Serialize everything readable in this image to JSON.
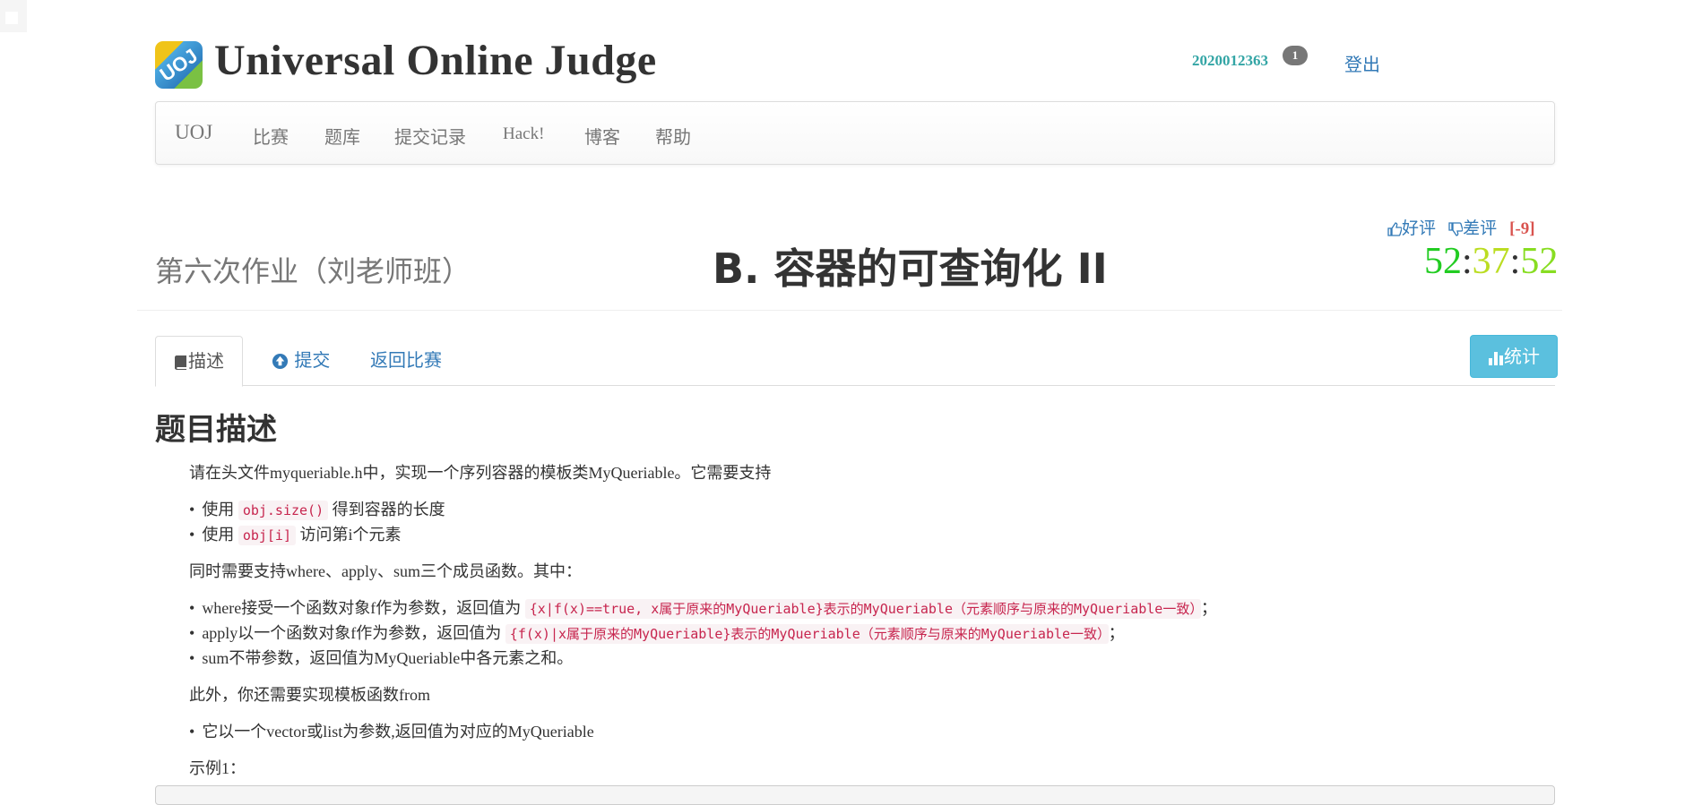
{
  "site": {
    "title": "Universal Online Judge",
    "logo_text": "UOJ"
  },
  "user": {
    "name": "2020012363",
    "badge": "1",
    "logout": "登出"
  },
  "navbar": {
    "brand": "UOJ",
    "items": [
      "比赛",
      "题库",
      "提交记录",
      "Hack!",
      "博客",
      "帮助"
    ]
  },
  "contest": {
    "name": "第六次作业（刘老师班）"
  },
  "problem": {
    "title": "B. 容器的可查询化 II"
  },
  "rating": {
    "like": "好评",
    "dislike": "差评",
    "score": "[-9]"
  },
  "timer": {
    "hours": "52",
    "minutes": "37",
    "seconds": "52",
    "colors": {
      "hours": "#22cc22",
      "minutes": "#bbdd22",
      "seconds": "#88dd22"
    }
  },
  "tabs": {
    "desc": "描述",
    "submit": "提交",
    "back": "返回比赛"
  },
  "stats_button": "统计",
  "content": {
    "heading": "题目描述",
    "intro": "请在头文件myqueriable.h中，实现一个序列容器的模板类MyQueriable。它需要支持",
    "list1": [
      {
        "pre": "使用 ",
        "code": "obj.size()",
        "post": " 得到容器的长度"
      },
      {
        "pre": "使用 ",
        "code": "obj[i]",
        "post": " 访问第i个元素"
      }
    ],
    "also": "同时需要支持where、apply、sum三个成员函数。其中：",
    "list2": [
      {
        "pre": "where接受一个函数对象f作为参数，返回值为 ",
        "code": "{x|f(x)==true, x属于原来的MyQueriable}表示的MyQueriable（元素顺序与原来的MyQueriable一致）",
        "post": "；"
      },
      {
        "pre": "apply以一个函数对象f作为参数，返回值为 ",
        "code": "{f(x)|x属于原来的MyQueriable}表示的MyQueriable（元素顺序与原来的MyQueriable一致）",
        "post": "；"
      },
      {
        "pre": "sum不带参数，返回值为MyQueriable中各元素之和。",
        "code": "",
        "post": ""
      }
    ],
    "besides": "此外，你还需要实现模板函数from",
    "list3": [
      "它以一个vector或list为参数,返回值为对应的MyQueriable"
    ],
    "example": "示例1："
  }
}
